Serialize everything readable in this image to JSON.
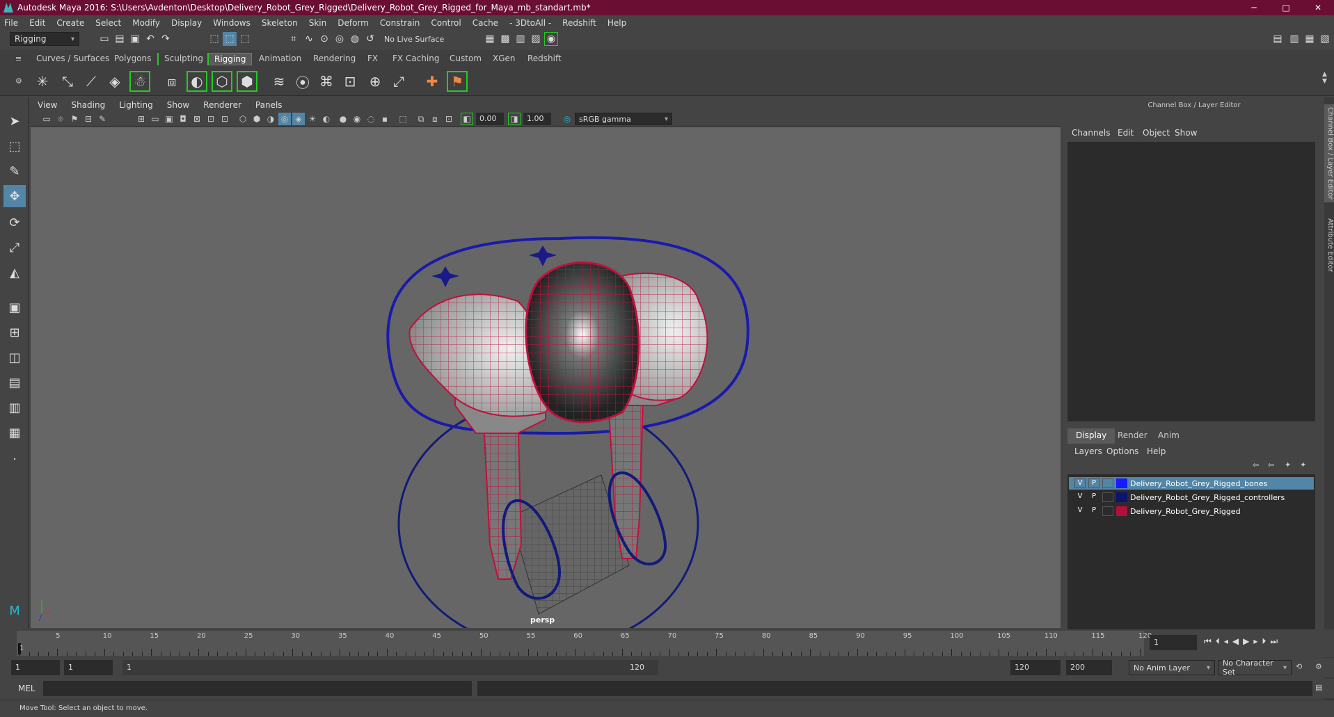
{
  "window": {
    "title": "Autodesk Maya 2016: S:\\Users\\Avdenton\\Desktop\\Delivery_Robot_Grey_Rigged\\Delivery_Robot_Grey_Rigged_for_Maya_mb_standart.mb*",
    "minimize": "─",
    "maximize": "□",
    "close": "✕"
  },
  "menubar": [
    "File",
    "Edit",
    "Create",
    "Select",
    "Modify",
    "Display",
    "Windows",
    "Skeleton",
    "Skin",
    "Deform",
    "Constrain",
    "Control",
    "Cache",
    "- 3DtoAll -",
    "Redshift",
    "Help"
  ],
  "statusline": {
    "mode": "Rigging",
    "live_surface": "No Live Surface"
  },
  "shelf": {
    "tabs": [
      "Curves / Surfaces",
      "Polygons",
      "Sculpting",
      "Rigging",
      "Animation",
      "Rendering",
      "FX",
      "FX Caching",
      "Custom",
      "XGen",
      "Redshift"
    ],
    "active": "Rigging"
  },
  "panel": {
    "menus": [
      "View",
      "Shading",
      "Lighting",
      "Show",
      "Renderer",
      "Panels"
    ],
    "exposure": "0.00",
    "gamma": "1.00",
    "color_space": "sRGB gamma",
    "camera_label": "persp"
  },
  "channel_box": {
    "title": "Channel Box / Layer Editor",
    "menus": [
      "Channels",
      "Edit",
      "Object",
      "Show"
    ],
    "side_tabs": [
      "Channel Box / Layer Editor",
      "Attribute Editor"
    ]
  },
  "layer_editor": {
    "tabs": [
      "Display",
      "Render",
      "Anim"
    ],
    "active_tab": "Display",
    "menus": [
      "Layers",
      "Options",
      "Help"
    ],
    "layers": [
      {
        "v": "V",
        "p": "P",
        "name": "Delivery_Robot_Grey_Rigged_bones",
        "color": "#1a1aff",
        "selected": true
      },
      {
        "v": "V",
        "p": "P",
        "name": "Delivery_Robot_Grey_Rigged_controllers",
        "color": "#0c1470",
        "selected": false
      },
      {
        "v": "V",
        "p": "P",
        "name": "Delivery_Robot_Grey_Rigged",
        "color": "#b0103a",
        "selected": false
      }
    ]
  },
  "timeline": {
    "ticks": [
      "5",
      "10",
      "15",
      "20",
      "25",
      "30",
      "35",
      "40",
      "45",
      "50",
      "55",
      "60",
      "65",
      "70",
      "75",
      "80",
      "85",
      "90",
      "95",
      "100",
      "105",
      "110",
      "115",
      "120"
    ],
    "start_marker": "1",
    "current_frame": "1"
  },
  "range": {
    "start": "1",
    "anim_start": "1",
    "slider_start": "1",
    "slider_end": "120",
    "anim_end": "120",
    "end": "200",
    "anim_layer": "No Anim Layer",
    "character_set": "No Character Set"
  },
  "command": {
    "label": "MEL"
  },
  "help_line": "Move Tool: Select an object to move.",
  "colors": {
    "title_bar": "#6b0e33",
    "wire_red": "#c0103c",
    "wire_blue": "#121a7a",
    "selection": "#5285a6"
  }
}
